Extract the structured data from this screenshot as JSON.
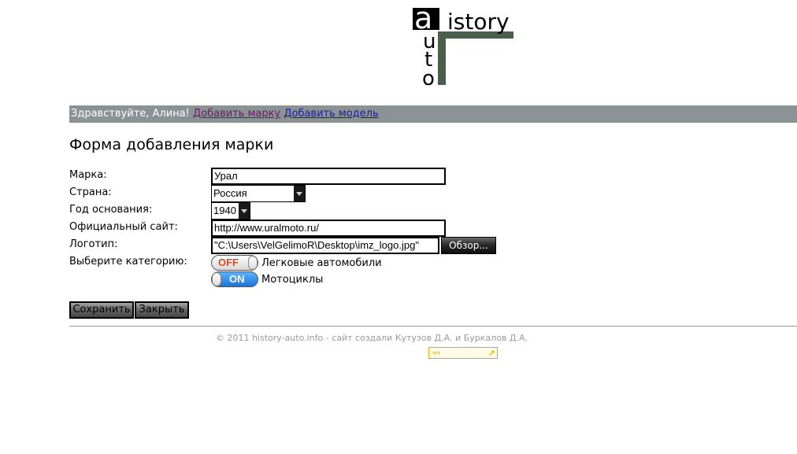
{
  "logo": {
    "main_text": "istory",
    "side_letters": [
      "a",
      "u",
      "t",
      "o"
    ],
    "accent_color": "#4a5e4c"
  },
  "navbar": {
    "greeting": "Здравствуйте, Алина!",
    "add_brand_link": "Добавить марку",
    "add_model_link": "Добавить модель"
  },
  "form": {
    "title": "Форма добавления марки",
    "brand": {
      "label": "Марка:",
      "value": "Урал"
    },
    "country": {
      "label": "Страна:",
      "value": "Россия"
    },
    "year": {
      "label": "Год основания:",
      "value": "1940"
    },
    "site": {
      "label": "Официальный сайт:",
      "value": "http://www.uralmoto.ru/"
    },
    "logo_file": {
      "label": "Логотип:",
      "value": "\"C:\\Users\\VelGelimoR\\Desktop\\imz_logo.jpg\"",
      "browse_label": "Обзор..."
    },
    "category": {
      "label": "Выберите категорию:",
      "items": [
        {
          "state_text": "OFF",
          "label": "Легковые автомобили"
        },
        {
          "state_text": "ON",
          "label": "Мотоциклы"
        }
      ]
    },
    "save_label": "Сохранить",
    "close_label": "Закрыть"
  },
  "footer": {
    "text": "© 2011 history-auto.info - сайт создали Кутузов Д.А. и Буркалов Д.А.",
    "counter_text": "чч"
  }
}
